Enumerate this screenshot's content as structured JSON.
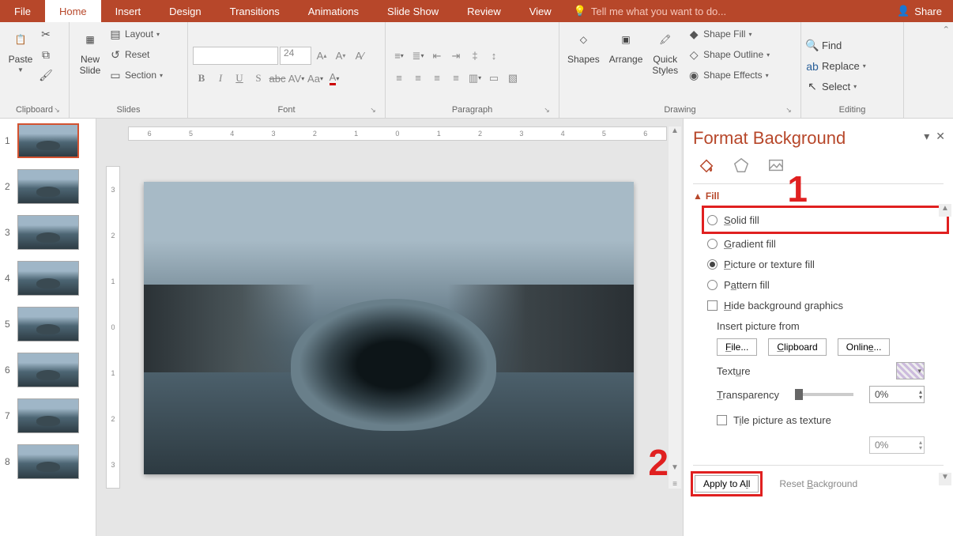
{
  "tabs": {
    "file": "File",
    "home": "Home",
    "insert": "Insert",
    "design": "Design",
    "transitions": "Transitions",
    "animations": "Animations",
    "slideshow": "Slide Show",
    "review": "Review",
    "view": "View"
  },
  "tellme": "Tell me what you want to do...",
  "share": "Share",
  "ribbon": {
    "clipboard": {
      "label": "Clipboard",
      "paste": "Paste"
    },
    "slides": {
      "label": "Slides",
      "newslide": "New\nSlide",
      "layout": "Layout",
      "reset": "Reset",
      "section": "Section"
    },
    "font": {
      "label": "Font",
      "size": "24"
    },
    "paragraph": {
      "label": "Paragraph"
    },
    "drawing": {
      "label": "Drawing",
      "shapes": "Shapes",
      "arrange": "Arrange",
      "quick": "Quick\nStyles",
      "fill": "Shape Fill",
      "outline": "Shape Outline",
      "effects": "Shape Effects"
    },
    "editing": {
      "label": "Editing",
      "find": "Find",
      "replace": "Replace",
      "select": "Select"
    }
  },
  "thumbs": [
    "1",
    "2",
    "3",
    "4",
    "5",
    "6",
    "7",
    "8"
  ],
  "ruler_h": [
    "6",
    "5",
    "4",
    "3",
    "2",
    "1",
    "0",
    "1",
    "2",
    "3",
    "4",
    "5",
    "6"
  ],
  "ruler_v": [
    "3",
    "2",
    "1",
    "0",
    "1",
    "2",
    "3"
  ],
  "pane": {
    "title": "Format Background",
    "fill": "Fill",
    "solid": "Solid fill",
    "gradient": "Gradient fill",
    "picture": "Picture or texture fill",
    "pattern": "Pattern fill",
    "hide": "Hide background graphics",
    "insertfrom": "Insert picture from",
    "file": "File...",
    "clipboard": "Clipboard",
    "online": "Online...",
    "texture": "Texture",
    "transparency": "Transparency",
    "transp_val": "0%",
    "tile": "Tile picture as texture",
    "offset_val": "0%",
    "apply": "Apply to All",
    "reset": "Reset Background"
  },
  "annot": {
    "n1": "1",
    "n2": "2"
  }
}
